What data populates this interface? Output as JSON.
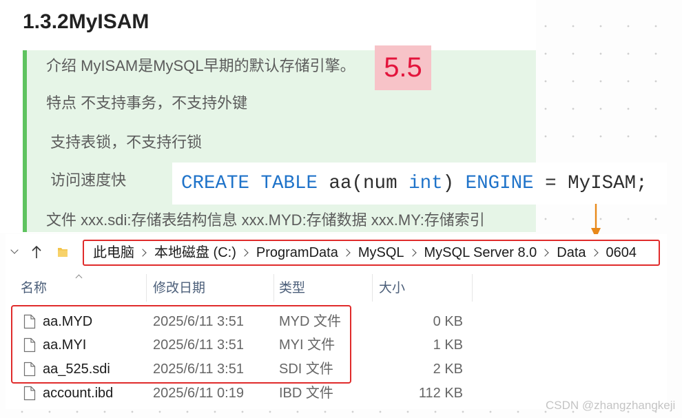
{
  "note": {
    "heading": "1.3.2MyISAM",
    "lines": [
      "介绍 MyISAM是MySQL早期的默认存储引擎。",
      "特点 不支持事务，不支持外键",
      " 支持表锁，不支持行锁",
      " 访问速度快",
      "文件 xxx.sdi:存储表结构信息 xxx.MYD:存储数据 xxx.MY:存储索引"
    ],
    "version_badge": "5.5"
  },
  "code": {
    "tokens": [
      {
        "text": "CREATE TABLE",
        "kind": "keyword"
      },
      {
        "text": " aa(num ",
        "kind": "plain"
      },
      {
        "text": "int",
        "kind": "keyword"
      },
      {
        "text": ") ",
        "kind": "plain"
      },
      {
        "text": "ENGINE",
        "kind": "keyword"
      },
      {
        "text": " = MyISAM;",
        "kind": "plain"
      }
    ]
  },
  "explorer": {
    "breadcrumb": [
      "此电脑",
      "本地磁盘 (C:)",
      "ProgramData",
      "MySQL",
      "MySQL Server 8.0",
      "Data",
      "0604"
    ],
    "columns": {
      "name": "名称",
      "modified": "修改日期",
      "type": "类型",
      "size": "大小"
    },
    "files": [
      {
        "name": "aa.MYD",
        "modified": "2025/6/11 3:51",
        "type": "MYD 文件",
        "size": "0 KB"
      },
      {
        "name": "aa.MYI",
        "modified": "2025/6/11 3:51",
        "type": "MYI 文件",
        "size": "1 KB"
      },
      {
        "name": "aa_525.sdi",
        "modified": "2025/6/11 3:51",
        "type": "SDI 文件",
        "size": "2 KB"
      },
      {
        "name": "account.ibd",
        "modified": "2025/6/11 0:19",
        "type": "IBD 文件",
        "size": "112 KB"
      }
    ]
  },
  "watermark": "CSDN @zhangzhangkeji",
  "icons": {
    "nav_expand": "chevron-down-icon",
    "nav_up": "up-arrow-icon",
    "location": "folder-icon",
    "breadcrumb_separator": "chevron-right-icon",
    "sort": "sort-ascending-icon",
    "file": "file-icon",
    "annotation": "arrow-down-icon"
  },
  "colors": {
    "keyword": "#1f73c9",
    "quote_background": "#e6f5e7",
    "quote_bar": "#5ec35f",
    "badge_background": "#f7c3c8",
    "badge_text": "#e3143c",
    "highlight_box": "#e02b2b",
    "arrow": "#e8891a"
  }
}
